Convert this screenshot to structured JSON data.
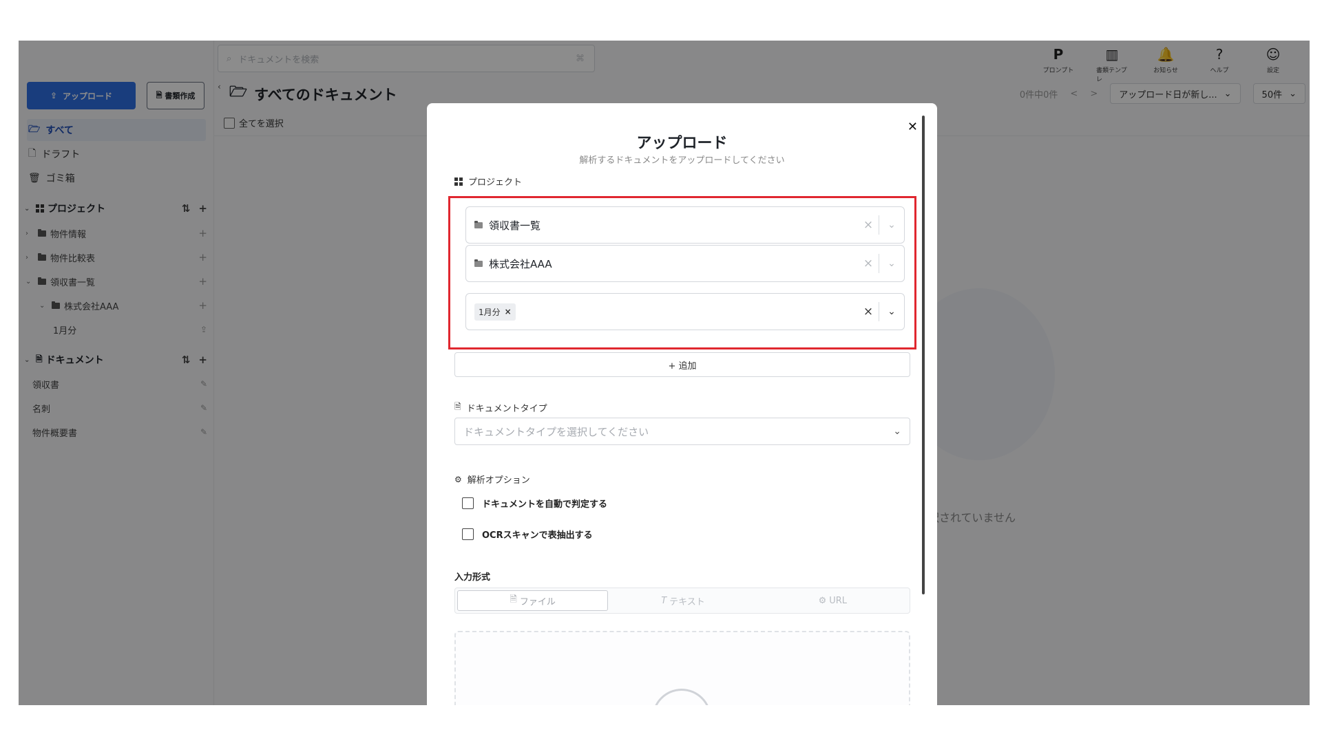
{
  "sidebar": {
    "upload_label": "アップロード",
    "create_label": "書類作成",
    "nav": [
      {
        "label": "すべて",
        "active": true
      },
      {
        "label": "ドラフト"
      },
      {
        "label": "ゴミ箱"
      }
    ],
    "projects_header": "プロジェクト",
    "projects": [
      {
        "label": "物件情報"
      },
      {
        "label": "物件比較表"
      },
      {
        "label": "領収書一覧"
      },
      {
        "label": "株式会社AAA"
      },
      {
        "label": "1月分"
      }
    ],
    "documents_header": "ドキュメント",
    "documents": [
      {
        "label": "領収書"
      },
      {
        "label": "名刺"
      },
      {
        "label": "物件概要書"
      }
    ]
  },
  "topbar": {
    "search_placeholder": "ドキュメントを検索",
    "icons": [
      {
        "label": "プロンプト",
        "glyph": "P"
      },
      {
        "label": "書類テンプレ",
        "glyph": "▥"
      },
      {
        "label": "お知らせ",
        "glyph": "🔔"
      },
      {
        "label": "ヘルプ",
        "glyph": "?"
      },
      {
        "label": "設定",
        "glyph": "☺"
      }
    ]
  },
  "main": {
    "title": "すべてのドキュメント",
    "select_all": "全てを選択",
    "count": "0件中0件",
    "prev": "<",
    "next": ">",
    "sort_label": "アップロード日が新し...",
    "page_size": "50件",
    "empty_text": "選択されていません"
  },
  "modal": {
    "title": "アップロード",
    "subtitle": "解析するドキュメントをアップロードしてください",
    "project_label": "プロジェクト",
    "project_selects": [
      {
        "value": "領収書一覧"
      },
      {
        "value": "株式会社AAA"
      }
    ],
    "tag": "1月分",
    "add_label": "+ 追加",
    "doctype_label": "ドキュメントタイプ",
    "doctype_placeholder": "ドキュメントタイプを選択してください",
    "options_label": "解析オプション",
    "options": [
      {
        "label": "ドキュメントを自動で判定する",
        "checked": false
      },
      {
        "label": "OCRスキャンで表抽出する",
        "checked": false
      }
    ],
    "format_label": "入力形式",
    "formats": [
      {
        "label": "ファイル",
        "icon": "🗎",
        "active": true
      },
      {
        "label": "テキスト",
        "icon": "T",
        "active": false
      },
      {
        "label": "URL",
        "icon": "⚙",
        "active": false
      }
    ]
  },
  "colors": {
    "primary": "#2f6fe4",
    "highlight": "#e0272f"
  }
}
